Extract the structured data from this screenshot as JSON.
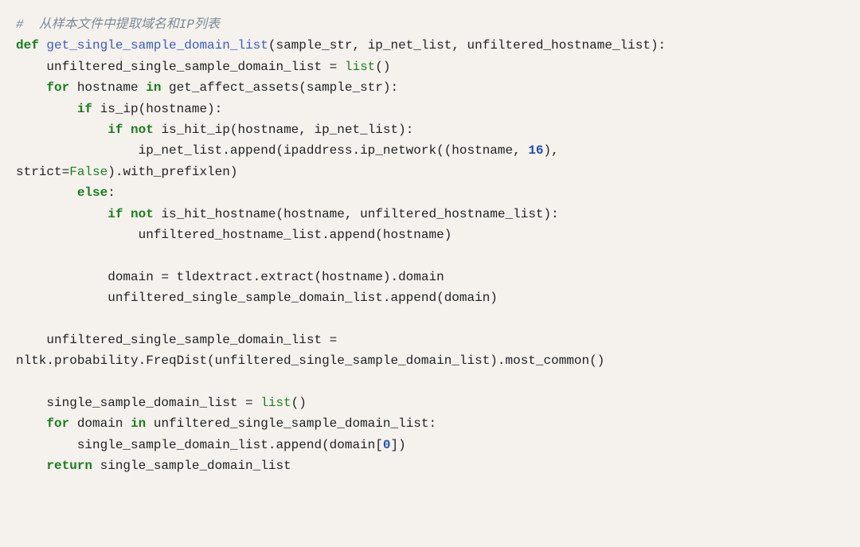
{
  "code": {
    "lines": [
      [
        {
          "cls": "tok-comment",
          "t": "#  从样本文件中提取域名和IP列表"
        }
      ],
      [
        {
          "cls": "tok-keyword",
          "t": "def"
        },
        {
          "cls": "tok-plain",
          "t": " "
        },
        {
          "cls": "tok-funcname",
          "t": "get_single_sample_domain_list"
        },
        {
          "cls": "tok-plain",
          "t": "(sample_str, ip_net_list, unfiltered_hostname_list):"
        }
      ],
      [
        {
          "cls": "tok-plain",
          "t": "    unfiltered_single_sample_domain_list = "
        },
        {
          "cls": "tok-builtin",
          "t": "list"
        },
        {
          "cls": "tok-plain",
          "t": "()"
        }
      ],
      [
        {
          "cls": "tok-plain",
          "t": "    "
        },
        {
          "cls": "tok-keyword",
          "t": "for"
        },
        {
          "cls": "tok-plain",
          "t": " hostname "
        },
        {
          "cls": "tok-keyword",
          "t": "in"
        },
        {
          "cls": "tok-plain",
          "t": " get_affect_assets(sample_str):"
        }
      ],
      [
        {
          "cls": "tok-plain",
          "t": "        "
        },
        {
          "cls": "tok-keyword",
          "t": "if"
        },
        {
          "cls": "tok-plain",
          "t": " is_ip(hostname):"
        }
      ],
      [
        {
          "cls": "tok-plain",
          "t": "            "
        },
        {
          "cls": "tok-keyword",
          "t": "if"
        },
        {
          "cls": "tok-plain",
          "t": " "
        },
        {
          "cls": "tok-keyword",
          "t": "not"
        },
        {
          "cls": "tok-plain",
          "t": " is_hit_ip(hostname, ip_net_list):"
        }
      ],
      [
        {
          "cls": "tok-plain",
          "t": "                ip_net_list.append(ipaddress.ip_network((hostname, "
        },
        {
          "cls": "tok-number",
          "t": "16"
        },
        {
          "cls": "tok-plain",
          "t": "), "
        }
      ],
      [
        {
          "cls": "tok-plain",
          "t": "strict="
        },
        {
          "cls": "tok-constant",
          "t": "False"
        },
        {
          "cls": "tok-plain",
          "t": ").with_prefixlen)"
        }
      ],
      [
        {
          "cls": "tok-plain",
          "t": "        "
        },
        {
          "cls": "tok-keyword",
          "t": "else"
        },
        {
          "cls": "tok-plain",
          "t": ":"
        }
      ],
      [
        {
          "cls": "tok-plain",
          "t": "            "
        },
        {
          "cls": "tok-keyword",
          "t": "if"
        },
        {
          "cls": "tok-plain",
          "t": " "
        },
        {
          "cls": "tok-keyword",
          "t": "not"
        },
        {
          "cls": "tok-plain",
          "t": " is_hit_hostname(hostname, unfiltered_hostname_list):"
        }
      ],
      [
        {
          "cls": "tok-plain",
          "t": "                unfiltered_hostname_list.append(hostname)"
        }
      ],
      [
        {
          "cls": "tok-plain",
          "t": ""
        }
      ],
      [
        {
          "cls": "tok-plain",
          "t": "            domain = tldextract.extract(hostname).domain"
        }
      ],
      [
        {
          "cls": "tok-plain",
          "t": "            unfiltered_single_sample_domain_list.append(domain)"
        }
      ],
      [
        {
          "cls": "tok-plain",
          "t": ""
        }
      ],
      [
        {
          "cls": "tok-plain",
          "t": "    unfiltered_single_sample_domain_list = "
        }
      ],
      [
        {
          "cls": "tok-plain",
          "t": "nltk.probability.FreqDist(unfiltered_single_sample_domain_list).most_common()"
        }
      ],
      [
        {
          "cls": "tok-plain",
          "t": ""
        }
      ],
      [
        {
          "cls": "tok-plain",
          "t": "    single_sample_domain_list = "
        },
        {
          "cls": "tok-builtin",
          "t": "list"
        },
        {
          "cls": "tok-plain",
          "t": "()"
        }
      ],
      [
        {
          "cls": "tok-plain",
          "t": "    "
        },
        {
          "cls": "tok-keyword",
          "t": "for"
        },
        {
          "cls": "tok-plain",
          "t": " domain "
        },
        {
          "cls": "tok-keyword",
          "t": "in"
        },
        {
          "cls": "tok-plain",
          "t": " unfiltered_single_sample_domain_list:"
        }
      ],
      [
        {
          "cls": "tok-plain",
          "t": "        single_sample_domain_list.append(domain["
        },
        {
          "cls": "tok-number",
          "t": "0"
        },
        {
          "cls": "tok-plain",
          "t": "])"
        }
      ],
      [
        {
          "cls": "tok-plain",
          "t": "    "
        },
        {
          "cls": "tok-keyword",
          "t": "return"
        },
        {
          "cls": "tok-plain",
          "t": " single_sample_domain_list"
        }
      ]
    ]
  }
}
